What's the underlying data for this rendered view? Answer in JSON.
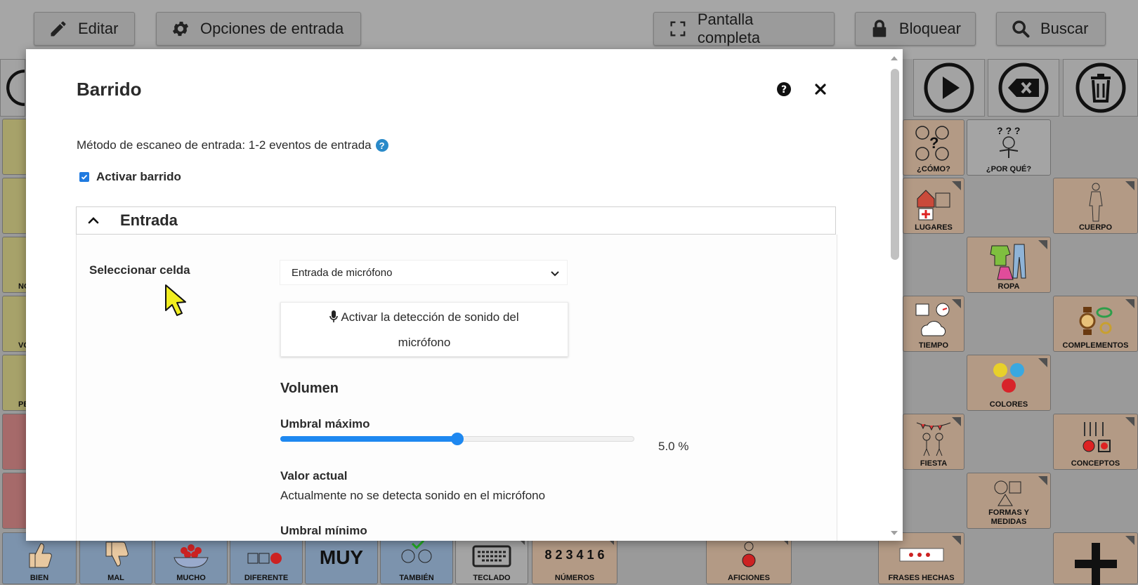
{
  "toolbar": {
    "edit": "Editar",
    "input_options": "Opciones de entrada",
    "fullscreen": "Pantalla completa",
    "lock": "Bloquear",
    "search": "Buscar"
  },
  "grid": {
    "right_cells": {
      "como": "¿CÓMO?",
      "por_que": "¿POR QUÉ?",
      "lugares": "LUGARES",
      "cuerpo": "CUERPO",
      "ropa": "ROPA",
      "tiempo": "TIEMPO",
      "complementos": "COMPLEMENTOS",
      "colores": "COLORES",
      "fiesta": "FIESTA",
      "conceptos": "CONCEPTOS",
      "formas": "FORMAS Y MEDIDAS"
    },
    "left_cells": {
      "no": "NO",
      "vo": "VO",
      "pe": "PE"
    },
    "bottom_cells": {
      "bien": "BIEN",
      "mal": "MAL",
      "mucho": "MUCHO",
      "diferente": "DIFERENTE",
      "muy": "MUY",
      "tambien": "TAMBIÉN",
      "teclado": "TECLADO",
      "numeros": "NÚMEROS",
      "numeros_glyph": "8 2 3 4 1 6",
      "aficiones": "AFICIONES",
      "frases": "FRASES HECHAS"
    }
  },
  "modal": {
    "title": "Barrido",
    "scan_method": "Método de escaneo de entrada: 1-2 eventos de entrada",
    "activate_label": "Activar barrido",
    "activate_checked": true,
    "section_title": "Entrada",
    "select_cell_label": "Seleccionar celda",
    "select_cell_value": "Entrada de micrófono",
    "mic_button_line1": "Activar la detección de sonido del",
    "mic_button_line2": "micrófono",
    "volume_heading": "Volumen",
    "max_threshold_label": "Umbral máximo",
    "max_threshold_percent": 5.0,
    "max_threshold_text": "5.0 %",
    "current_value_label": "Valor actual",
    "current_value_text": "Actualmente no se detecta sonido en el micrófono",
    "min_threshold_label": "Umbral mínimo"
  },
  "colors": {
    "accent": "#1e88f0",
    "help_blue": "#2a8ac9"
  }
}
